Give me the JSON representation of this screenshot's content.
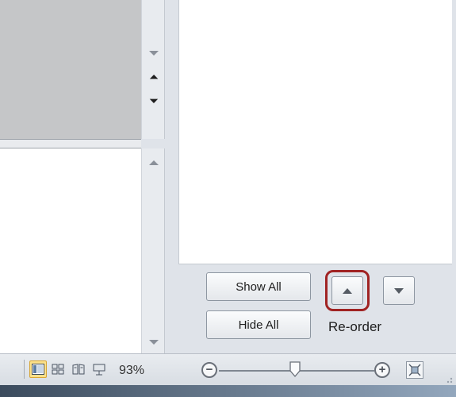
{
  "task_pane": {
    "show_all_label": "Show All",
    "hide_all_label": "Hide All",
    "reorder_label": "Re-order"
  },
  "status_bar": {
    "zoom_level": "93%",
    "zoom_percent": 93,
    "views": [
      "normal",
      "slide-sorter",
      "reading-view",
      "slide-show"
    ],
    "active_view": "normal"
  },
  "colors": {
    "highlight_border": "#a02323",
    "active_view_bg": "#fbe08a"
  },
  "icons": {
    "scroll_down": "chevron-down-icon",
    "scroll_up": "chevron-up-icon",
    "previous_slide": "double-chevron-up-icon",
    "next_slide": "double-chevron-down-icon",
    "zoom_out": "minus-circle-icon",
    "zoom_in": "plus-circle-icon",
    "fit_window": "fit-to-window-icon"
  }
}
